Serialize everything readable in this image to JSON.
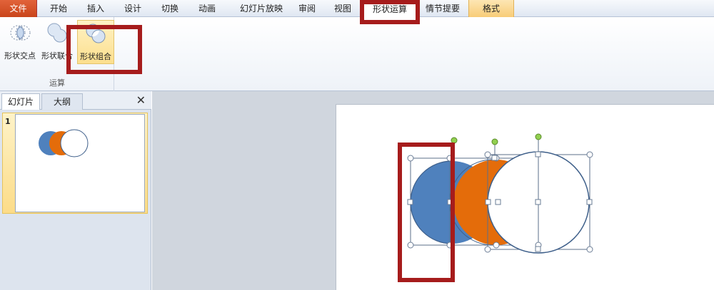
{
  "ribbon": {
    "tabs": [
      {
        "label": "文件"
      },
      {
        "label": "开始"
      },
      {
        "label": "插入"
      },
      {
        "label": "设计"
      },
      {
        "label": "切换"
      },
      {
        "label": "动画"
      },
      {
        "label": "幻灯片放映"
      },
      {
        "label": "审阅"
      },
      {
        "label": "视图"
      },
      {
        "label": "形状运算"
      },
      {
        "label": "情节提要"
      },
      {
        "label": "格式"
      }
    ],
    "group": {
      "label": "运算",
      "buttons": [
        {
          "label": "形状交点",
          "icon": "shape-intersect-icon"
        },
        {
          "label": "形状联合",
          "icon": "shape-union-icon"
        },
        {
          "label": "形状组合",
          "icon": "shape-combine-icon"
        }
      ]
    }
  },
  "left_pane": {
    "tabs": [
      {
        "label": "幻灯片"
      },
      {
        "label": "大纲"
      }
    ],
    "close": "✕",
    "slide_number": "1"
  },
  "colors": {
    "blue": "#4f81bd",
    "orange": "#e46c0a",
    "outline": "#3e5f8a",
    "annotation": "#a61c1c"
  }
}
